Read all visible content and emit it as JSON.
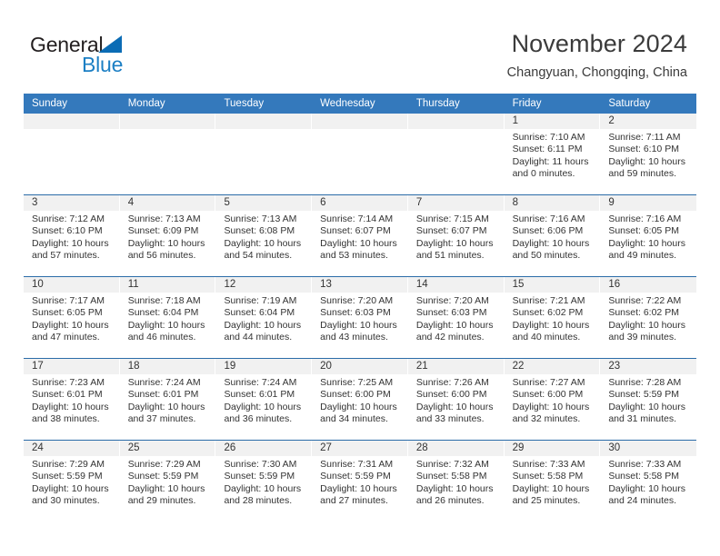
{
  "brand": {
    "name_part1": "General",
    "name_part2": "Blue"
  },
  "header": {
    "title": "November 2024",
    "subtitle": "Changyuan, Chongqing, China"
  },
  "colors": {
    "header_blue": "#3479bc",
    "row_border_blue": "#2b6ca8",
    "daynum_band": "#f1f1f1",
    "logo_blue": "#1c7fc4",
    "text": "#333333"
  },
  "weekdays": [
    "Sunday",
    "Monday",
    "Tuesday",
    "Wednesday",
    "Thursday",
    "Friday",
    "Saturday"
  ],
  "weeks": [
    [
      {
        "day": "",
        "empty": true
      },
      {
        "day": "",
        "empty": true
      },
      {
        "day": "",
        "empty": true
      },
      {
        "day": "",
        "empty": true
      },
      {
        "day": "",
        "empty": true
      },
      {
        "day": "1",
        "sunrise": "Sunrise: 7:10 AM",
        "sunset": "Sunset: 6:11 PM",
        "daylight1": "Daylight: 11 hours",
        "daylight2": "and 0 minutes."
      },
      {
        "day": "2",
        "sunrise": "Sunrise: 7:11 AM",
        "sunset": "Sunset: 6:10 PM",
        "daylight1": "Daylight: 10 hours",
        "daylight2": "and 59 minutes."
      }
    ],
    [
      {
        "day": "3",
        "sunrise": "Sunrise: 7:12 AM",
        "sunset": "Sunset: 6:10 PM",
        "daylight1": "Daylight: 10 hours",
        "daylight2": "and 57 minutes."
      },
      {
        "day": "4",
        "sunrise": "Sunrise: 7:13 AM",
        "sunset": "Sunset: 6:09 PM",
        "daylight1": "Daylight: 10 hours",
        "daylight2": "and 56 minutes."
      },
      {
        "day": "5",
        "sunrise": "Sunrise: 7:13 AM",
        "sunset": "Sunset: 6:08 PM",
        "daylight1": "Daylight: 10 hours",
        "daylight2": "and 54 minutes."
      },
      {
        "day": "6",
        "sunrise": "Sunrise: 7:14 AM",
        "sunset": "Sunset: 6:07 PM",
        "daylight1": "Daylight: 10 hours",
        "daylight2": "and 53 minutes."
      },
      {
        "day": "7",
        "sunrise": "Sunrise: 7:15 AM",
        "sunset": "Sunset: 6:07 PM",
        "daylight1": "Daylight: 10 hours",
        "daylight2": "and 51 minutes."
      },
      {
        "day": "8",
        "sunrise": "Sunrise: 7:16 AM",
        "sunset": "Sunset: 6:06 PM",
        "daylight1": "Daylight: 10 hours",
        "daylight2": "and 50 minutes."
      },
      {
        "day": "9",
        "sunrise": "Sunrise: 7:16 AM",
        "sunset": "Sunset: 6:05 PM",
        "daylight1": "Daylight: 10 hours",
        "daylight2": "and 49 minutes."
      }
    ],
    [
      {
        "day": "10",
        "sunrise": "Sunrise: 7:17 AM",
        "sunset": "Sunset: 6:05 PM",
        "daylight1": "Daylight: 10 hours",
        "daylight2": "and 47 minutes."
      },
      {
        "day": "11",
        "sunrise": "Sunrise: 7:18 AM",
        "sunset": "Sunset: 6:04 PM",
        "daylight1": "Daylight: 10 hours",
        "daylight2": "and 46 minutes."
      },
      {
        "day": "12",
        "sunrise": "Sunrise: 7:19 AM",
        "sunset": "Sunset: 6:04 PM",
        "daylight1": "Daylight: 10 hours",
        "daylight2": "and 44 minutes."
      },
      {
        "day": "13",
        "sunrise": "Sunrise: 7:20 AM",
        "sunset": "Sunset: 6:03 PM",
        "daylight1": "Daylight: 10 hours",
        "daylight2": "and 43 minutes."
      },
      {
        "day": "14",
        "sunrise": "Sunrise: 7:20 AM",
        "sunset": "Sunset: 6:03 PM",
        "daylight1": "Daylight: 10 hours",
        "daylight2": "and 42 minutes."
      },
      {
        "day": "15",
        "sunrise": "Sunrise: 7:21 AM",
        "sunset": "Sunset: 6:02 PM",
        "daylight1": "Daylight: 10 hours",
        "daylight2": "and 40 minutes."
      },
      {
        "day": "16",
        "sunrise": "Sunrise: 7:22 AM",
        "sunset": "Sunset: 6:02 PM",
        "daylight1": "Daylight: 10 hours",
        "daylight2": "and 39 minutes."
      }
    ],
    [
      {
        "day": "17",
        "sunrise": "Sunrise: 7:23 AM",
        "sunset": "Sunset: 6:01 PM",
        "daylight1": "Daylight: 10 hours",
        "daylight2": "and 38 minutes."
      },
      {
        "day": "18",
        "sunrise": "Sunrise: 7:24 AM",
        "sunset": "Sunset: 6:01 PM",
        "daylight1": "Daylight: 10 hours",
        "daylight2": "and 37 minutes."
      },
      {
        "day": "19",
        "sunrise": "Sunrise: 7:24 AM",
        "sunset": "Sunset: 6:01 PM",
        "daylight1": "Daylight: 10 hours",
        "daylight2": "and 36 minutes."
      },
      {
        "day": "20",
        "sunrise": "Sunrise: 7:25 AM",
        "sunset": "Sunset: 6:00 PM",
        "daylight1": "Daylight: 10 hours",
        "daylight2": "and 34 minutes."
      },
      {
        "day": "21",
        "sunrise": "Sunrise: 7:26 AM",
        "sunset": "Sunset: 6:00 PM",
        "daylight1": "Daylight: 10 hours",
        "daylight2": "and 33 minutes."
      },
      {
        "day": "22",
        "sunrise": "Sunrise: 7:27 AM",
        "sunset": "Sunset: 6:00 PM",
        "daylight1": "Daylight: 10 hours",
        "daylight2": "and 32 minutes."
      },
      {
        "day": "23",
        "sunrise": "Sunrise: 7:28 AM",
        "sunset": "Sunset: 5:59 PM",
        "daylight1": "Daylight: 10 hours",
        "daylight2": "and 31 minutes."
      }
    ],
    [
      {
        "day": "24",
        "sunrise": "Sunrise: 7:29 AM",
        "sunset": "Sunset: 5:59 PM",
        "daylight1": "Daylight: 10 hours",
        "daylight2": "and 30 minutes."
      },
      {
        "day": "25",
        "sunrise": "Sunrise: 7:29 AM",
        "sunset": "Sunset: 5:59 PM",
        "daylight1": "Daylight: 10 hours",
        "daylight2": "and 29 minutes."
      },
      {
        "day": "26",
        "sunrise": "Sunrise: 7:30 AM",
        "sunset": "Sunset: 5:59 PM",
        "daylight1": "Daylight: 10 hours",
        "daylight2": "and 28 minutes."
      },
      {
        "day": "27",
        "sunrise": "Sunrise: 7:31 AM",
        "sunset": "Sunset: 5:59 PM",
        "daylight1": "Daylight: 10 hours",
        "daylight2": "and 27 minutes."
      },
      {
        "day": "28",
        "sunrise": "Sunrise: 7:32 AM",
        "sunset": "Sunset: 5:58 PM",
        "daylight1": "Daylight: 10 hours",
        "daylight2": "and 26 minutes."
      },
      {
        "day": "29",
        "sunrise": "Sunrise: 7:33 AM",
        "sunset": "Sunset: 5:58 PM",
        "daylight1": "Daylight: 10 hours",
        "daylight2": "and 25 minutes."
      },
      {
        "day": "30",
        "sunrise": "Sunrise: 7:33 AM",
        "sunset": "Sunset: 5:58 PM",
        "daylight1": "Daylight: 10 hours",
        "daylight2": "and 24 minutes."
      }
    ]
  ]
}
